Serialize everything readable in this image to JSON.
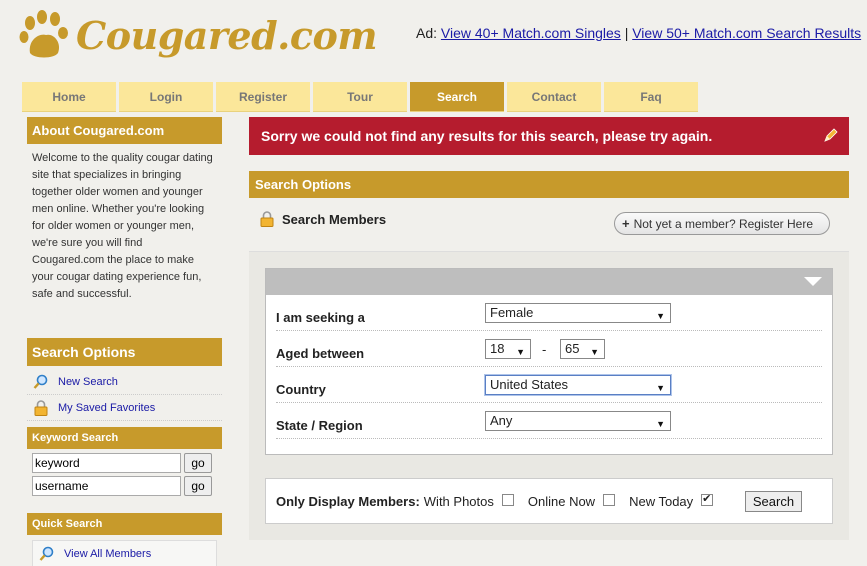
{
  "site": {
    "name": "Cougared.com"
  },
  "ad": {
    "prefix": "Ad:",
    "link1": "View 40+ Match.com Singles",
    "separator": "|",
    "link2": "View 50+ Match.com Search Results"
  },
  "nav": {
    "items": [
      {
        "label": "Home"
      },
      {
        "label": "Login"
      },
      {
        "label": "Register"
      },
      {
        "label": "Tour"
      },
      {
        "label": "Search"
      },
      {
        "label": "Contact"
      },
      {
        "label": "Faq"
      }
    ],
    "active": "Search"
  },
  "sidebar": {
    "about_title": "About Cougared.com",
    "about_text": "Welcome to the quality cougar dating site that specializes in bringing together older women and younger men online. Whether you're looking for older women or younger men, we're sure you will find Cougared.com the place to make your cougar dating experience fun, safe and successful.",
    "search_options_title": "Search Options",
    "new_search": "New Search",
    "saved_favorites": "My Saved Favorites",
    "keyword_title": "Keyword Search",
    "keyword_value": "keyword",
    "username_value": "username",
    "go_label": "go",
    "quick_title": "Quick Search",
    "view_all": "View All Members"
  },
  "main": {
    "error": "Sorry we could not find any results for this search, please try again.",
    "options_title": "Search Options",
    "search_members": "Search Members",
    "register_button": "Not yet a member? Register Here",
    "form": {
      "seeking_label": "I am seeking a",
      "seeking_value": "Female",
      "aged_label": "Aged between",
      "age_min": "18",
      "age_dash": "-",
      "age_max": "65",
      "country_label": "Country",
      "country_value": "United States",
      "state_label": "State / Region",
      "state_value": "Any"
    },
    "filter": {
      "label": "Only Display Members:",
      "with_photos": "With Photos",
      "with_photos_checked": false,
      "online_now": "Online Now",
      "online_now_checked": false,
      "new_today": "New Today",
      "new_today_checked": true,
      "search_button": "Search"
    }
  },
  "colors": {
    "accent": "#c79a2b",
    "nav_bg": "#fbe79a",
    "error_bg": "#b51c2e",
    "link": "#1a1aa6"
  }
}
